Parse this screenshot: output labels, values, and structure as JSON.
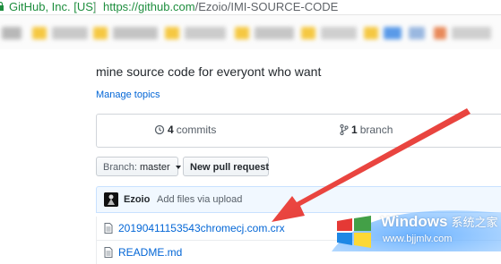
{
  "browser": {
    "site_label": "GitHub, Inc. [US]",
    "url_host": "https://github.com",
    "url_path": "/Ezoio/IMI-SOURCE-CODE"
  },
  "repo": {
    "description": "mine source code for everyont who want",
    "manage_topics": "Manage topics",
    "commits_count": "4",
    "commits_label": "commits",
    "branch_count": "1",
    "branch_label": "branch"
  },
  "toolbar": {
    "branch_prefix": "Branch:",
    "branch_value": "master",
    "new_pr": "New pull request"
  },
  "latest_commit": {
    "author": "Ezoio",
    "message": "Add files via upload"
  },
  "files": [
    {
      "name": "20190411153543chromecj.com.crx"
    },
    {
      "name": "README.md"
    }
  ],
  "watermark": {
    "brand": "Windows",
    "brand_cn": "系统之家",
    "url": "www.bjjmlv.com"
  },
  "colors": {
    "link": "#0366d6",
    "annotation_arrow": "#e53935",
    "secure_green": "#1e8e3e"
  }
}
